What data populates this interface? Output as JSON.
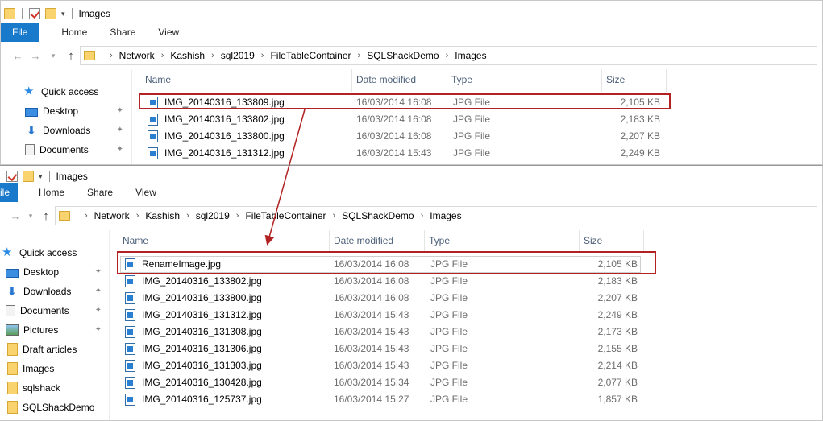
{
  "top_window": {
    "title": "Images",
    "ribbon_tabs": [
      "File",
      "Home",
      "Share",
      "View"
    ],
    "breadcrumb": [
      "Network",
      "Kashish",
      "sql2019",
      "FileTableContainer",
      "SQLShackDemo",
      "Images"
    ],
    "columns": [
      "Name",
      "Date modified",
      "Type",
      "Size"
    ],
    "nav_items": [
      "Quick access",
      "Desktop",
      "Downloads",
      "Documents"
    ],
    "files": [
      {
        "name": "IMG_20140316_133809.jpg",
        "date": "16/03/2014 16:08",
        "type": "JPG File",
        "size": "2,105 KB"
      },
      {
        "name": "IMG_20140316_133802.jpg",
        "date": "16/03/2014 16:08",
        "type": "JPG File",
        "size": "2,183 KB"
      },
      {
        "name": "IMG_20140316_133800.jpg",
        "date": "16/03/2014 16:08",
        "type": "JPG File",
        "size": "2,207 KB"
      },
      {
        "name": "IMG_20140316_131312.jpg",
        "date": "16/03/2014 15:43",
        "type": "JPG File",
        "size": "2,249 KB"
      }
    ]
  },
  "bottom_window": {
    "title": "Images",
    "ribbon_tabs": [
      "ile",
      "Home",
      "Share",
      "View"
    ],
    "breadcrumb": [
      "Network",
      "Kashish",
      "sql2019",
      "FileTableContainer",
      "SQLShackDemo",
      "Images"
    ],
    "columns": [
      "Name",
      "Date modified",
      "Type",
      "Size"
    ],
    "nav_items": [
      "Quick access",
      "Desktop",
      "Downloads",
      "Documents",
      "Pictures",
      "Draft articles",
      "Images",
      "sqlshack",
      "SQLShackDemo"
    ],
    "files": [
      {
        "name": "RenameImage.jpg",
        "date": "16/03/2014 16:08",
        "type": "JPG File",
        "size": "2,105 KB"
      },
      {
        "name": "IMG_20140316_133802.jpg",
        "date": "16/03/2014 16:08",
        "type": "JPG File",
        "size": "2,183 KB"
      },
      {
        "name": "IMG_20140316_133800.jpg",
        "date": "16/03/2014 16:08",
        "type": "JPG File",
        "size": "2,207 KB"
      },
      {
        "name": "IMG_20140316_131312.jpg",
        "date": "16/03/2014 15:43",
        "type": "JPG File",
        "size": "2,249 KB"
      },
      {
        "name": "IMG_20140316_131308.jpg",
        "date": "16/03/2014 15:43",
        "type": "JPG File",
        "size": "2,173 KB"
      },
      {
        "name": "IMG_20140316_131306.jpg",
        "date": "16/03/2014 15:43",
        "type": "JPG File",
        "size": "2,155 KB"
      },
      {
        "name": "IMG_20140316_131303.jpg",
        "date": "16/03/2014 15:43",
        "type": "JPG File",
        "size": "2,214 KB"
      },
      {
        "name": "IMG_20140316_130428.jpg",
        "date": "16/03/2014 15:34",
        "type": "JPG File",
        "size": "2,077 KB"
      },
      {
        "name": "IMG_20140316_125737.jpg",
        "date": "16/03/2014 15:27",
        "type": "JPG File",
        "size": "1,857 KB"
      }
    ]
  },
  "colors": {
    "file_tab": "#1979ca",
    "highlight": "#b22222",
    "header_text": "#4c607a"
  }
}
